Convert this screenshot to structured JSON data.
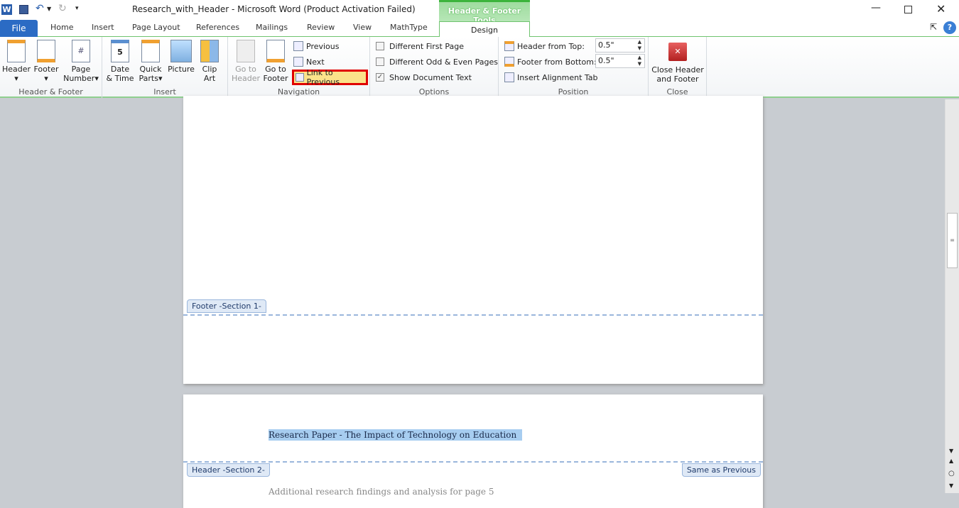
{
  "window": {
    "title": "Research_with_Header  -  Microsoft Word (Product Activation Failed)",
    "app_icon": "W"
  },
  "tabs": [
    "File",
    "Home",
    "Insert",
    "Page Layout",
    "References",
    "Mailings",
    "Review",
    "View",
    "MathType"
  ],
  "contextual": {
    "title": "Header & Footer Tools",
    "tab": "Design",
    "color": "#3cb43c"
  },
  "ribbon": {
    "header_footer": {
      "label": "Header & Footer",
      "header": "Header",
      "footer": "Footer",
      "page_number_1": "Page",
      "page_number_2": "Number"
    },
    "insert": {
      "label": "Insert",
      "date_1": "Date",
      "date_2": "& Time",
      "quick_1": "Quick",
      "quick_2": "Parts",
      "picture": "Picture",
      "clip_1": "Clip",
      "clip_2": "Art"
    },
    "navigation": {
      "label": "Navigation",
      "goto_header_1": "Go to",
      "goto_header_2": "Header",
      "goto_footer_1": "Go to",
      "goto_footer_2": "Footer",
      "previous": "Previous",
      "next": "Next",
      "link_previous": "Link to Previous"
    },
    "options": {
      "label": "Options",
      "first_page": "Different First Page",
      "first_page_checked": false,
      "odd_even": "Different Odd & Even Pages",
      "odd_even_checked": false,
      "show_text": "Show Document Text",
      "show_text_checked": true
    },
    "position": {
      "label": "Position",
      "header_top": "Header from Top:",
      "header_top_value": "0.5\"",
      "footer_bottom": "Footer from Bottom:",
      "footer_bottom_value": "0.5\"",
      "align_tab": "Insert Alignment Tab"
    },
    "close": {
      "label": "Close",
      "btn_1": "Close Header",
      "btn_2": "and Footer"
    }
  },
  "document": {
    "footer_label": "Footer -Section 1-",
    "header_label": "Header -Section 2-",
    "same_as_previous": "Same as Previous",
    "header_text": "Research Paper - The Impact of Technology on Education",
    "body_text": "Additional research findings and analysis for page 5"
  }
}
